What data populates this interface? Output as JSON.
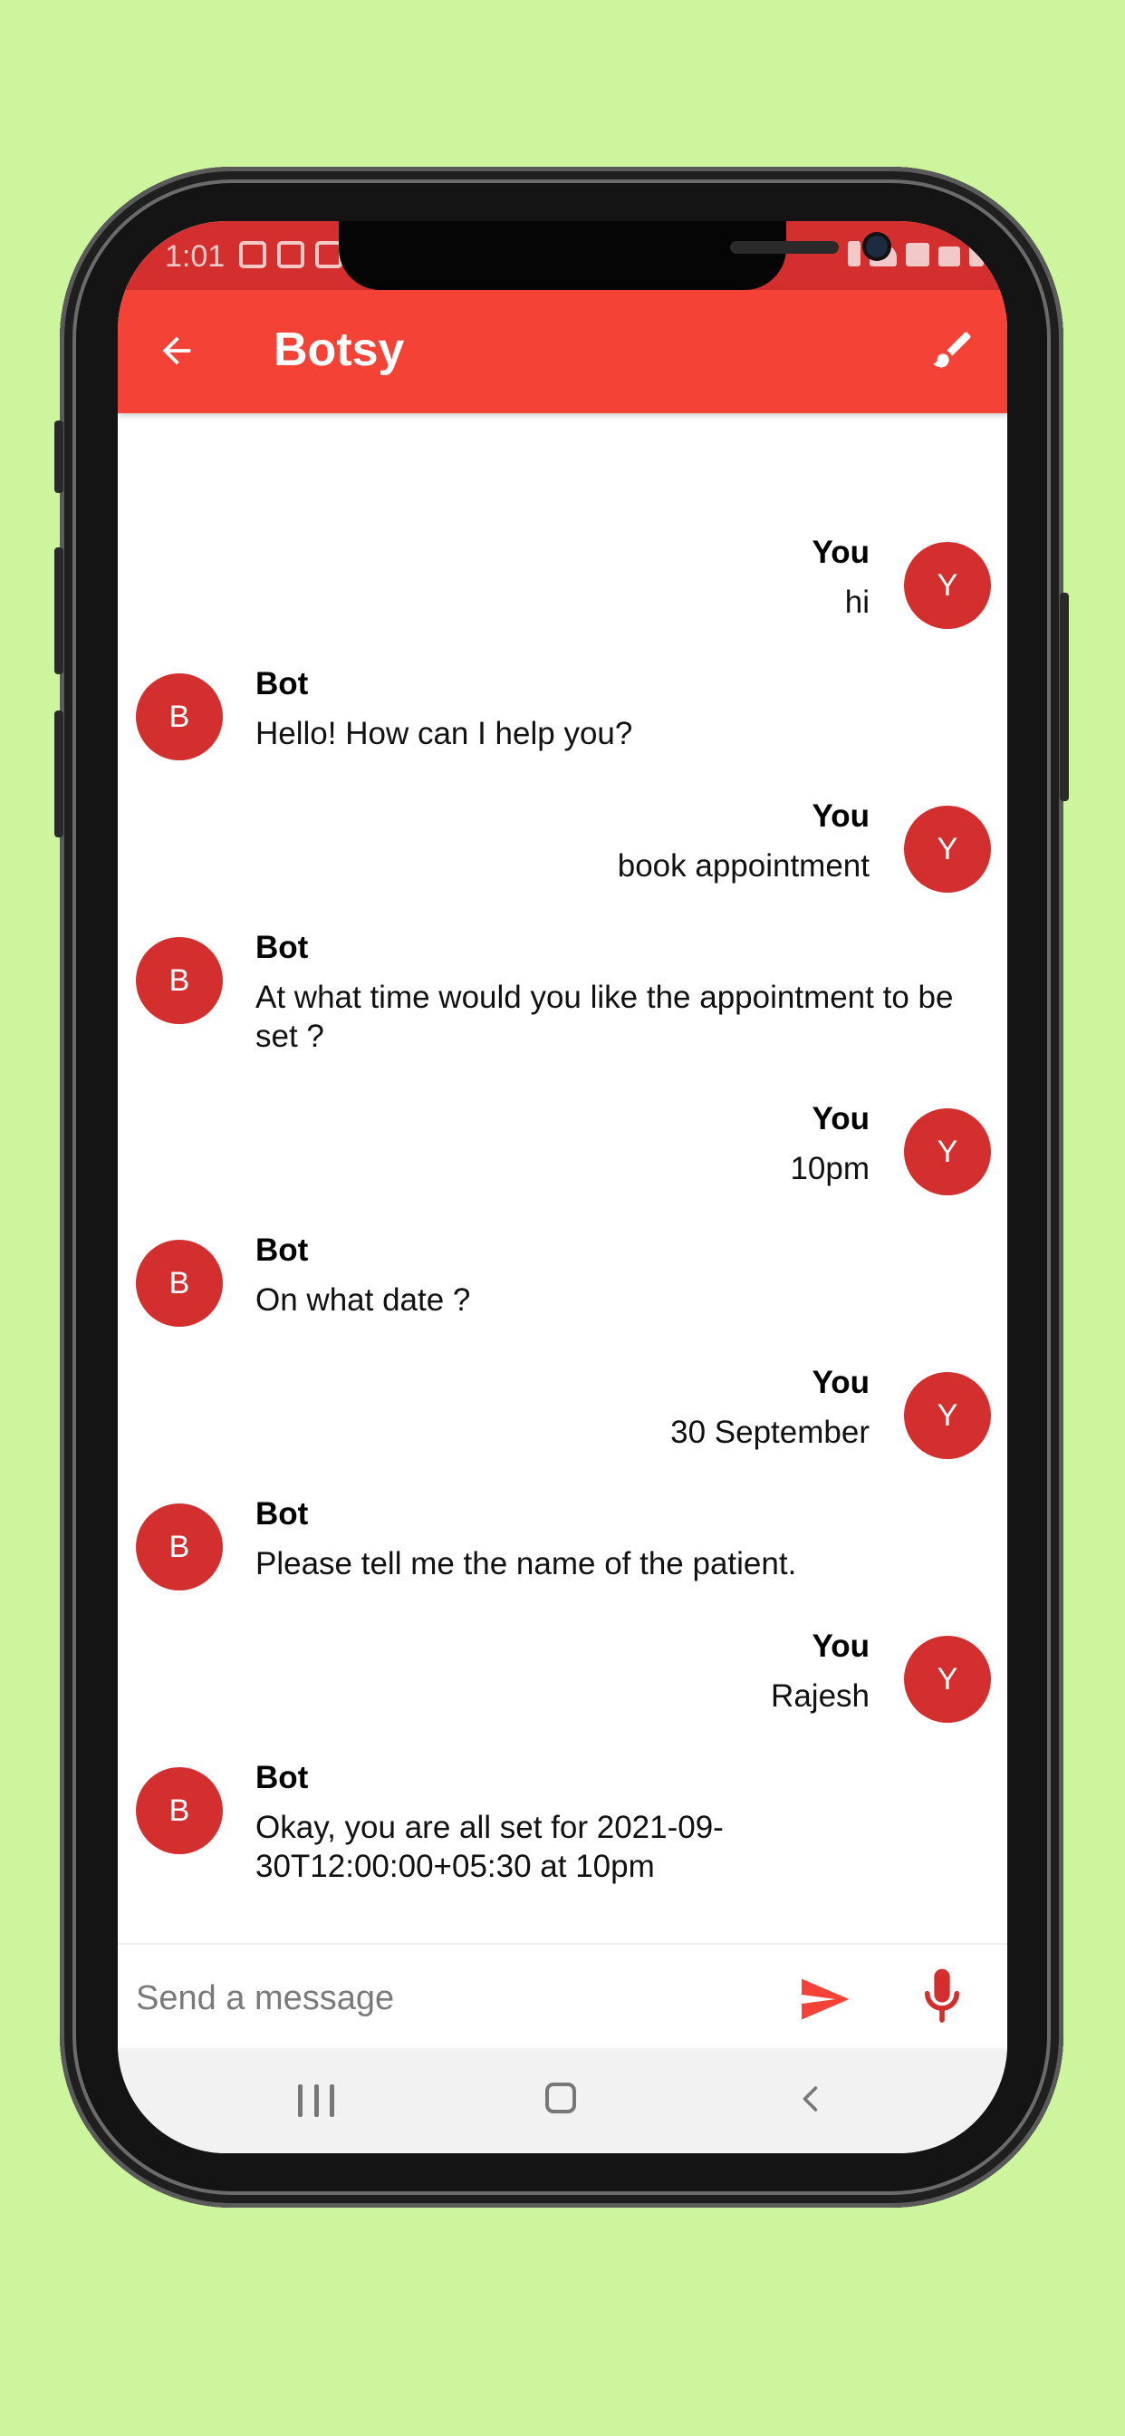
{
  "status_bar": {
    "time": "1:01"
  },
  "app_bar": {
    "title": "Botsy",
    "back_icon": "arrow-back-icon",
    "theme_icon": "brush-icon"
  },
  "messages": [
    {
      "sender": "You",
      "text": "hi",
      "avatar": "Y",
      "role": "user"
    },
    {
      "sender": "Bot",
      "text": "Hello! How can I help you?",
      "avatar": "B",
      "role": "bot"
    },
    {
      "sender": "You",
      "text": "book appointment",
      "avatar": "Y",
      "role": "user"
    },
    {
      "sender": "Bot",
      "text": "At what time would you like the appointment to be set ?",
      "avatar": "B",
      "role": "bot"
    },
    {
      "sender": "You",
      "text": "10pm",
      "avatar": "Y",
      "role": "user"
    },
    {
      "sender": "Bot",
      "text": "On what date ?",
      "avatar": "B",
      "role": "bot"
    },
    {
      "sender": "You",
      "text": "30 September",
      "avatar": "Y",
      "role": "user"
    },
    {
      "sender": "Bot",
      "text": "Please tell me the name of the patient.",
      "avatar": "B",
      "role": "bot"
    },
    {
      "sender": "You",
      "text": "Rajesh",
      "avatar": "Y",
      "role": "user"
    },
    {
      "sender": "Bot",
      "text": "Okay, you are all set for 2021-09-30T12:00:00+05:30 at 10pm",
      "avatar": "B",
      "role": "bot"
    }
  ],
  "composer": {
    "placeholder": "Send a message",
    "value": "",
    "send_icon": "send-icon",
    "mic_icon": "mic-icon"
  },
  "colors": {
    "appbar": "#f44336",
    "statusbar": "#d32f2f",
    "avatar": "#d32f2f",
    "background": "#cdf59e"
  }
}
